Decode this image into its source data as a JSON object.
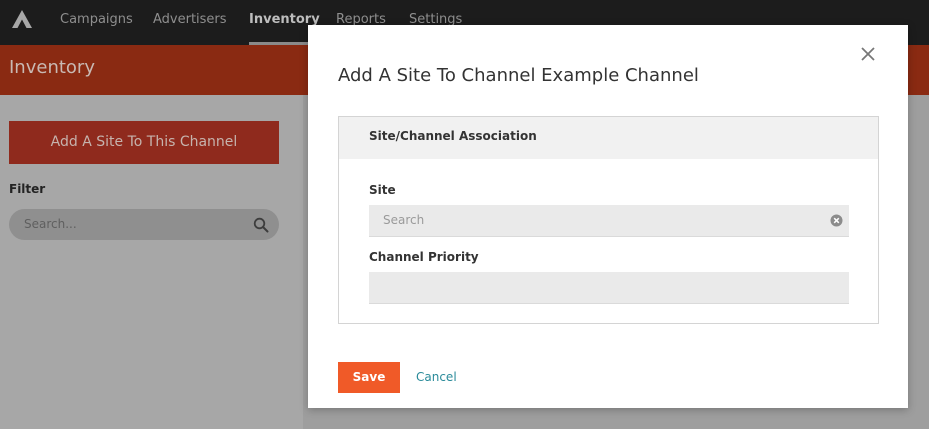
{
  "nav": {
    "logo_icon": "chevron-logo-icon",
    "items": [
      {
        "label": "Campaigns",
        "active": false
      },
      {
        "label": "Advertisers",
        "active": false
      },
      {
        "label": "Inventory",
        "active": true
      },
      {
        "label": "Reports",
        "active": false
      },
      {
        "label": "Settings",
        "active": false
      }
    ]
  },
  "page": {
    "title": "Inventory",
    "accent_color": "#e8401c"
  },
  "sidebar": {
    "add_button_label": "Add A Site To This Channel",
    "filter_label": "Filter",
    "search_placeholder": "Search...",
    "search_icon": "search-icon"
  },
  "modal": {
    "title": "Add A Site To Channel Example Channel",
    "close_icon": "close-icon",
    "panel_title": "Site/Channel Association",
    "site_label": "Site",
    "site_placeholder": "Search",
    "site_clear_icon": "clear-circle-icon",
    "priority_label": "Channel Priority",
    "priority_value": "",
    "save_label": "Save",
    "cancel_label": "Cancel",
    "save_color": "#f05a28",
    "cancel_color": "#2a8b9a"
  }
}
